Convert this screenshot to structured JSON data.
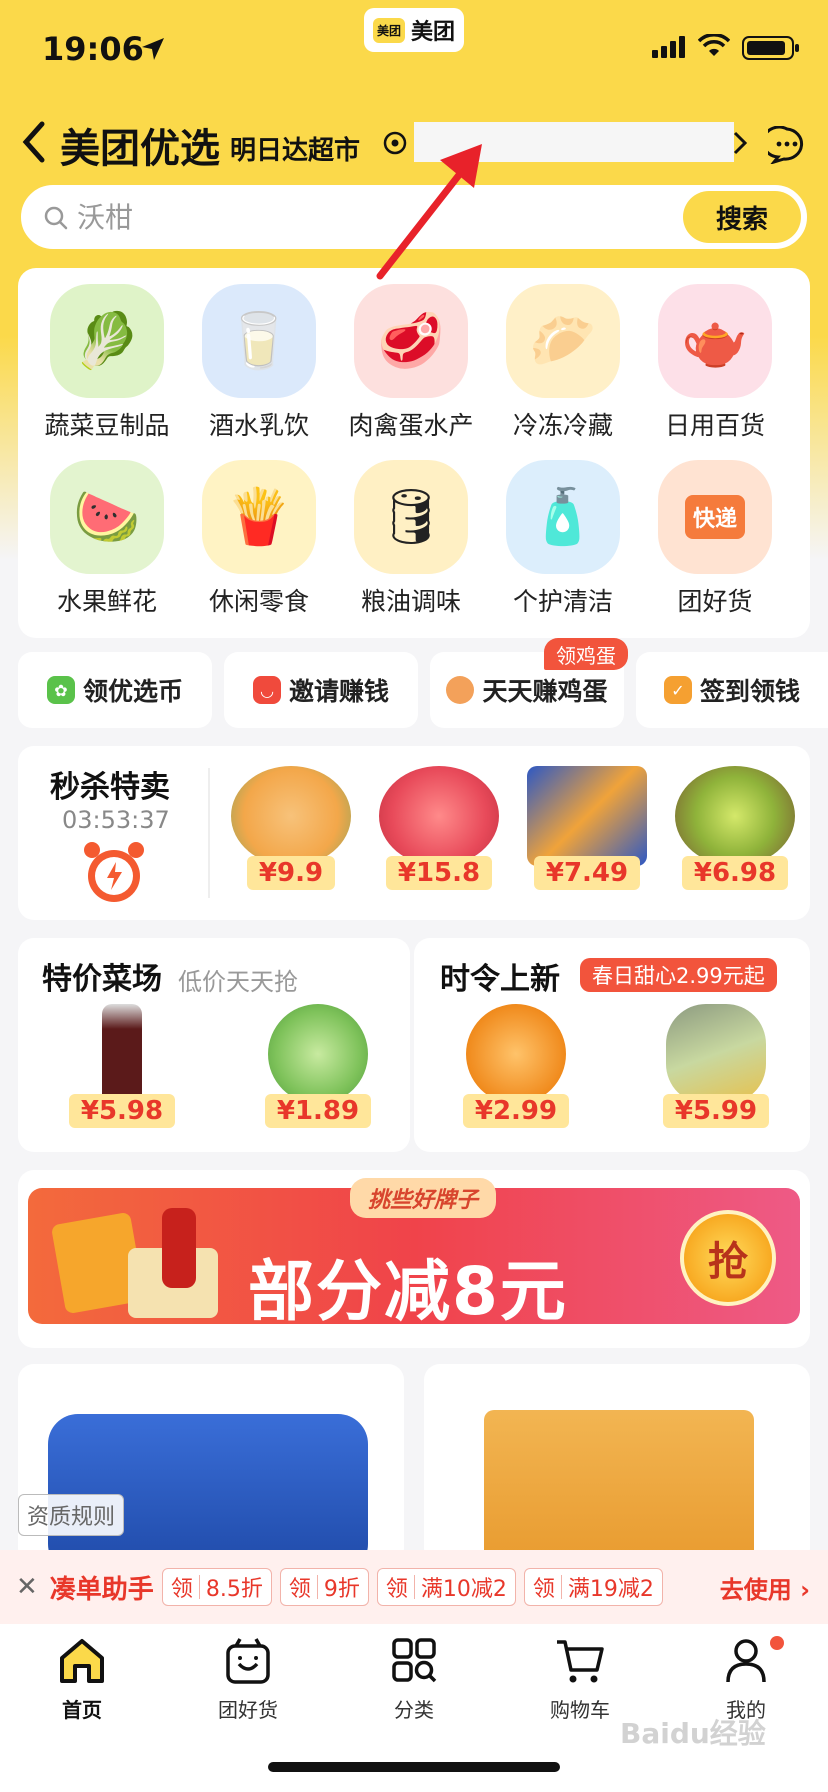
{
  "status_bar": {
    "time": "19:06"
  },
  "app_pill": {
    "logo": "美团",
    "name": "美团"
  },
  "header": {
    "brand": "美团优选",
    "store": "明日达超市"
  },
  "search": {
    "placeholder": "沃柑",
    "button": "搜索"
  },
  "categories": [
    {
      "label": "蔬菜豆制品",
      "icon": "vegetable-icon",
      "emoji": "🥬",
      "bg": "#dff3c8"
    },
    {
      "label": "酒水乳饮",
      "icon": "milk-icon",
      "emoji": "🥛",
      "bg": "#dbe9fb"
    },
    {
      "label": "肉禽蛋水产",
      "icon": "meat-icon",
      "emoji": "🥩",
      "bg": "#fde0de"
    },
    {
      "label": "冷冻冷藏",
      "icon": "bun-icon",
      "emoji": "🥟",
      "bg": "#fff0c8"
    },
    {
      "label": "日用百货",
      "icon": "kettle-icon",
      "emoji": "🫖",
      "bg": "#fde0e8"
    },
    {
      "label": "水果鲜花",
      "icon": "watermelon-icon",
      "emoji": "🍉",
      "bg": "#e3f4cf"
    },
    {
      "label": "休闲零食",
      "icon": "snack-icon",
      "emoji": "🍟",
      "bg": "#fff3c4"
    },
    {
      "label": "粮油调味",
      "icon": "oil-icon",
      "emoji": "🛢",
      "bg": "#fff0c4"
    },
    {
      "label": "个护清洁",
      "icon": "cleaning-icon",
      "emoji": "🧴",
      "bg": "#dceefc"
    },
    {
      "label": "团好货",
      "icon": "delivery-truck-icon",
      "emoji": "🚚",
      "bg": "#ffe3d2"
    }
  ],
  "delivery_label": "快递",
  "quick_pills": [
    {
      "label": "领优选币",
      "icon_color": "#5ac24a"
    },
    {
      "label": "邀请赚钱",
      "icon_color": "#f04a3c"
    },
    {
      "label": "天天赚鸡蛋",
      "icon_color": "#f3a15a"
    },
    {
      "label": "签到领钱",
      "icon_color": "#f5a031"
    }
  ],
  "egg_badge": "领鸡蛋",
  "flash_sale": {
    "title": "秒杀特卖",
    "countdown": "03:53:37",
    "items": [
      {
        "name": "melon",
        "price": "¥9.9",
        "color": "#f3a74a"
      },
      {
        "name": "apple",
        "price": "¥15.8",
        "color": "#e84a5a"
      },
      {
        "name": "rolls",
        "price": "¥7.49",
        "color": "#2d58c4"
      },
      {
        "name": "kiwi",
        "price": "¥6.98",
        "color": "#8fb33a"
      }
    ]
  },
  "special_market": {
    "title": "特价菜场",
    "subtitle": "低价天天抢",
    "items": [
      {
        "name": "soy-sauce",
        "price": "¥5.98",
        "color": "#5b1a1a"
      },
      {
        "name": "lettuce",
        "price": "¥1.89",
        "color": "#7ec25a"
      }
    ]
  },
  "seasonal": {
    "title": "时令上新",
    "tag": "春日甜心2.99元起",
    "items": [
      {
        "name": "orange",
        "price": "¥2.99",
        "color": "#f08a1c"
      },
      {
        "name": "corn",
        "price": "¥5.99",
        "color": "#c8d8a0"
      }
    ]
  },
  "banner": {
    "top_label": "挑些好牌子",
    "headline": "部分减8元",
    "grab": "抢"
  },
  "qualification": "资质规则",
  "coupon_bar": {
    "title": "凑单助手",
    "coupons": [
      {
        "prefix": "领",
        "value": "8.5折"
      },
      {
        "prefix": "领",
        "value": "9折"
      },
      {
        "prefix": "领",
        "value": "满10减2"
      },
      {
        "prefix": "领",
        "value": "满19减2"
      }
    ],
    "action": "去使用"
  },
  "tabs": [
    {
      "label": "首页",
      "icon": "home-icon"
    },
    {
      "label": "团好货",
      "icon": "bag-icon"
    },
    {
      "label": "分类",
      "icon": "grid-icon"
    },
    {
      "label": "购物车",
      "icon": "cart-icon"
    },
    {
      "label": "我的",
      "icon": "profile-icon"
    }
  ],
  "watermark": "Baidu经验",
  "colors": {
    "brand_yellow": "#fbd94a",
    "price_red": "#e8372a"
  }
}
